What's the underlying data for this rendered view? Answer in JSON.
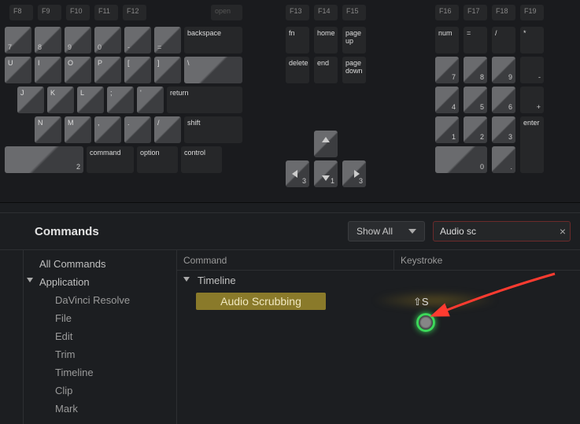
{
  "keyboard_rows": {
    "fn_left": [
      "F8",
      "F9",
      "F10",
      "F11",
      "F12"
    ],
    "fn_open": "open",
    "fn_mid": [
      "F13",
      "F14",
      "F15"
    ],
    "fn_right": [
      "F16",
      "F17",
      "F18",
      "F19"
    ],
    "nav1": [
      "fn",
      "home",
      "page up"
    ],
    "nav2": [
      "delete",
      "end",
      "page down"
    ],
    "modifiers": {
      "backspace": "backspace",
      "return": "return",
      "shift": "shift",
      "command": "command",
      "option": "option",
      "control": "control",
      "enter": "enter"
    },
    "main_row1_labels": [
      "7",
      "8",
      "9",
      "0",
      "-",
      "="
    ],
    "main_row2_labels": [
      "U",
      "I",
      "O",
      "P",
      "[",
      "]",
      "\\"
    ],
    "main_row3_labels": [
      "J",
      "K",
      "L",
      ";",
      "'"
    ],
    "main_row4_labels": [
      "N",
      "M",
      ",",
      ".",
      "/"
    ],
    "numpad": {
      "row0": [
        "num",
        "=",
        "/",
        "*"
      ],
      "row1": [
        "7",
        "8",
        "9",
        "-"
      ],
      "row2": [
        "4",
        "5",
        "6",
        "+"
      ],
      "row3": [
        "1",
        "2",
        "3"
      ],
      "row4": [
        "0",
        "0",
        "."
      ]
    },
    "arrow_sub": {
      "left": "3",
      "down": "1",
      "right": "3"
    }
  },
  "panel": {
    "title": "Commands",
    "filter_label": "Show All",
    "search_value": "Audio sc",
    "columns": {
      "command": "Command",
      "keystroke": "Keystroke"
    },
    "tree": {
      "all": "All Commands",
      "app": "Application",
      "children": [
        "DaVinci Resolve",
        "File",
        "Edit",
        "Trim",
        "Timeline",
        "Clip",
        "Mark"
      ]
    },
    "result": {
      "group": "Timeline",
      "command": "Audio Scrubbing",
      "keystroke": "⇧S"
    }
  }
}
